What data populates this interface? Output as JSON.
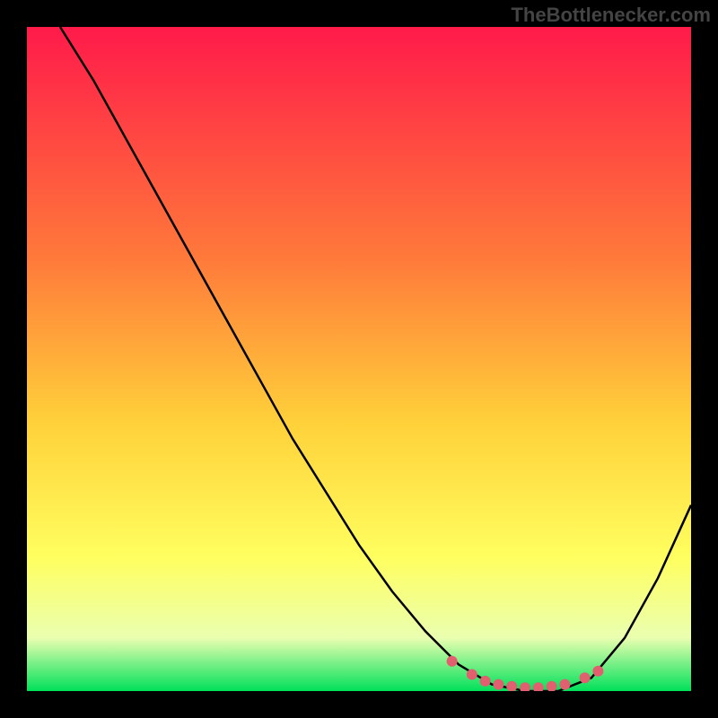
{
  "watermark": "TheBottlenecker.com",
  "chart_data": {
    "type": "line",
    "title": "",
    "xlabel": "",
    "ylabel": "",
    "xlim": [
      0,
      100
    ],
    "ylim": [
      0,
      100
    ],
    "gradient_stops": [
      {
        "offset": 0,
        "color": "#ff1a4a"
      },
      {
        "offset": 35,
        "color": "#ff7a3a"
      },
      {
        "offset": 60,
        "color": "#ffd23a"
      },
      {
        "offset": 80,
        "color": "#ffff60"
      },
      {
        "offset": 92,
        "color": "#eaffb0"
      },
      {
        "offset": 100,
        "color": "#00e05a"
      }
    ],
    "series": [
      {
        "name": "curve",
        "color": "#000000",
        "points": [
          {
            "x": 5,
            "y": 100
          },
          {
            "x": 10,
            "y": 92
          },
          {
            "x": 15,
            "y": 83
          },
          {
            "x": 20,
            "y": 74
          },
          {
            "x": 25,
            "y": 65
          },
          {
            "x": 30,
            "y": 56
          },
          {
            "x": 35,
            "y": 47
          },
          {
            "x": 40,
            "y": 38
          },
          {
            "x": 45,
            "y": 30
          },
          {
            "x": 50,
            "y": 22
          },
          {
            "x": 55,
            "y": 15
          },
          {
            "x": 60,
            "y": 9
          },
          {
            "x": 65,
            "y": 4
          },
          {
            "x": 70,
            "y": 1
          },
          {
            "x": 75,
            "y": 0
          },
          {
            "x": 80,
            "y": 0
          },
          {
            "x": 85,
            "y": 2
          },
          {
            "x": 90,
            "y": 8
          },
          {
            "x": 95,
            "y": 17
          },
          {
            "x": 100,
            "y": 28
          }
        ]
      }
    ],
    "bottom_markers": {
      "color": "#e06070",
      "points": [
        {
          "x": 64,
          "y": 4.5
        },
        {
          "x": 67,
          "y": 2.5
        },
        {
          "x": 69,
          "y": 1.5
        },
        {
          "x": 71,
          "y": 1
        },
        {
          "x": 73,
          "y": 0.7
        },
        {
          "x": 75,
          "y": 0.5
        },
        {
          "x": 77,
          "y": 0.5
        },
        {
          "x": 79,
          "y": 0.7
        },
        {
          "x": 81,
          "y": 1
        },
        {
          "x": 84,
          "y": 2
        },
        {
          "x": 86,
          "y": 3
        }
      ]
    }
  }
}
